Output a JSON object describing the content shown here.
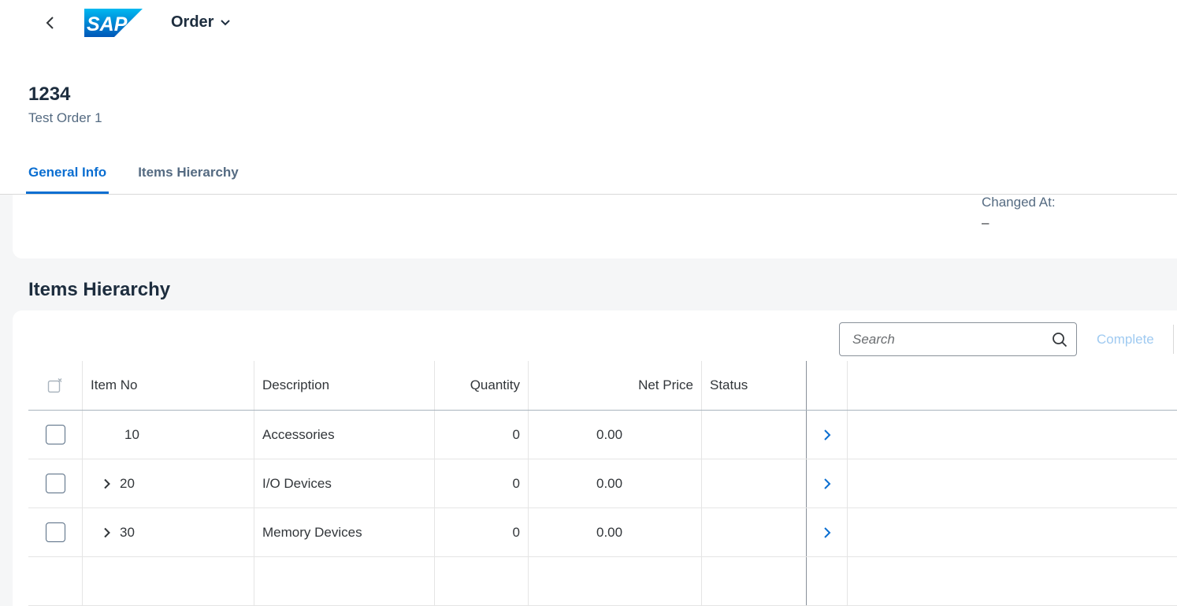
{
  "header": {
    "app_title": "Order",
    "logo_text": "SAP",
    "brand_color": "#0a6ed1",
    "object_title": "1234",
    "object_subtitle": "Test Order 1"
  },
  "tabs": [
    {
      "label": "General Info",
      "active": true
    },
    {
      "label": "Items Hierarchy",
      "active": false
    }
  ],
  "general_info": {
    "changed_at_label": "Changed At:",
    "changed_at_value": "–"
  },
  "items_section": {
    "title": "Items Hierarchy",
    "search_placeholder": "Search",
    "complete_label": "Complete"
  },
  "table": {
    "columns": [
      "Item No",
      "Description",
      "Quantity",
      "Net Price",
      "Status"
    ],
    "rows": [
      {
        "item_no": "10",
        "description": "Accessories",
        "quantity": "0",
        "net_price": "0.00",
        "status": "",
        "expandable": false
      },
      {
        "item_no": "20",
        "description": "I/O Devices",
        "quantity": "0",
        "net_price": "0.00",
        "status": "",
        "expandable": true
      },
      {
        "item_no": "30",
        "description": "Memory Devices",
        "quantity": "0",
        "net_price": "0.00",
        "status": "",
        "expandable": true
      }
    ]
  },
  "icons": {
    "back": "chevron-left-icon",
    "title_menu": "chevron-down-icon",
    "search": "search-icon",
    "clear_selection": "clear-selection-icon",
    "row_expand": "chevron-right-icon",
    "row_navigate": "navigation-arrow-icon"
  }
}
